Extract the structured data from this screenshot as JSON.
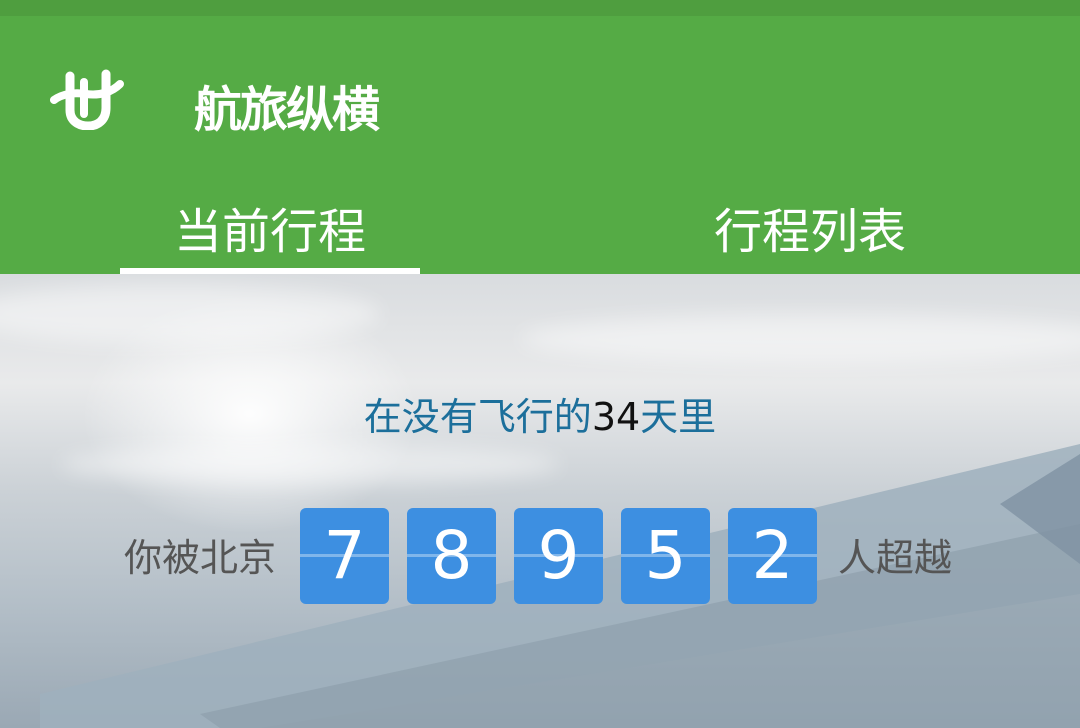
{
  "app": {
    "title": "航旅纵横"
  },
  "tabs": [
    {
      "label": "当前行程",
      "active": true
    },
    {
      "label": "行程列表",
      "active": false
    }
  ],
  "stats": {
    "prefix": "在没有飞行的",
    "days": "34",
    "suffix": "天里",
    "surpassed_prefix": "你被北京",
    "digits": [
      "7",
      "8",
      "9",
      "5",
      "2"
    ],
    "surpassed_suffix": "人超越"
  },
  "colors": {
    "header_green": "#55ab45",
    "digit_blue": "#3d8fe1",
    "headline_blue": "#1c6f9b"
  }
}
